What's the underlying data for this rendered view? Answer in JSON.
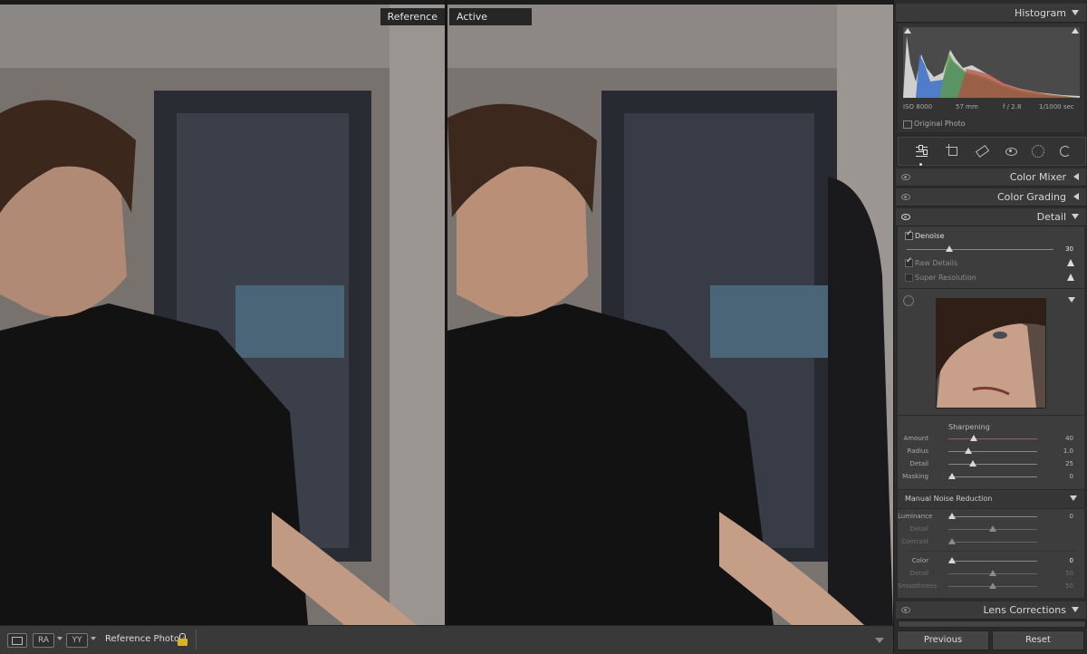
{
  "compare": {
    "reference_label": "Reference",
    "active_label": "Active"
  },
  "toolbar": {
    "ra_label": "RA",
    "yy_label": "YY",
    "reference_photo_label": "Reference Photo :"
  },
  "histogram": {
    "title": "Histogram",
    "iso": "ISO 8000",
    "focal": "57 mm",
    "aperture": "f / 2.8",
    "shutter": "1/1000 sec",
    "original_photo": "Original Photo"
  },
  "tools": [
    "edit-icon",
    "crop-icon",
    "heal-icon",
    "redeye-icon",
    "masking-icon",
    "presets-icon"
  ],
  "sections": {
    "color_mixer": "Color Mixer",
    "color_grading": "Color Grading",
    "detail": "Detail",
    "lens_corrections": "Lens Corrections"
  },
  "denoise": {
    "label": "Denoise",
    "value": "30",
    "raw_details": "Raw Details",
    "super_resolution": "Super Resolution"
  },
  "sharpening": {
    "title": "Sharpening",
    "amount_label": "Amount",
    "amount": "40",
    "radius_label": "Radius",
    "radius": "1.0",
    "detail_label": "Detail",
    "detail": "25",
    "masking_label": "Masking",
    "masking": "0"
  },
  "noise": {
    "title": "Manual Noise Reduction",
    "luminance_label": "Luminance",
    "luminance": "0",
    "lum_detail_label": "Detail",
    "lum_detail": "",
    "contrast_label": "Contrast",
    "contrast": "",
    "color_label": "Color",
    "color": "0",
    "color_detail_label": "Detail",
    "color_detail": "50",
    "smoothness_label": "Smoothness",
    "smoothness": "50"
  },
  "buttons": {
    "previous": "Previous",
    "reset": "Reset"
  }
}
